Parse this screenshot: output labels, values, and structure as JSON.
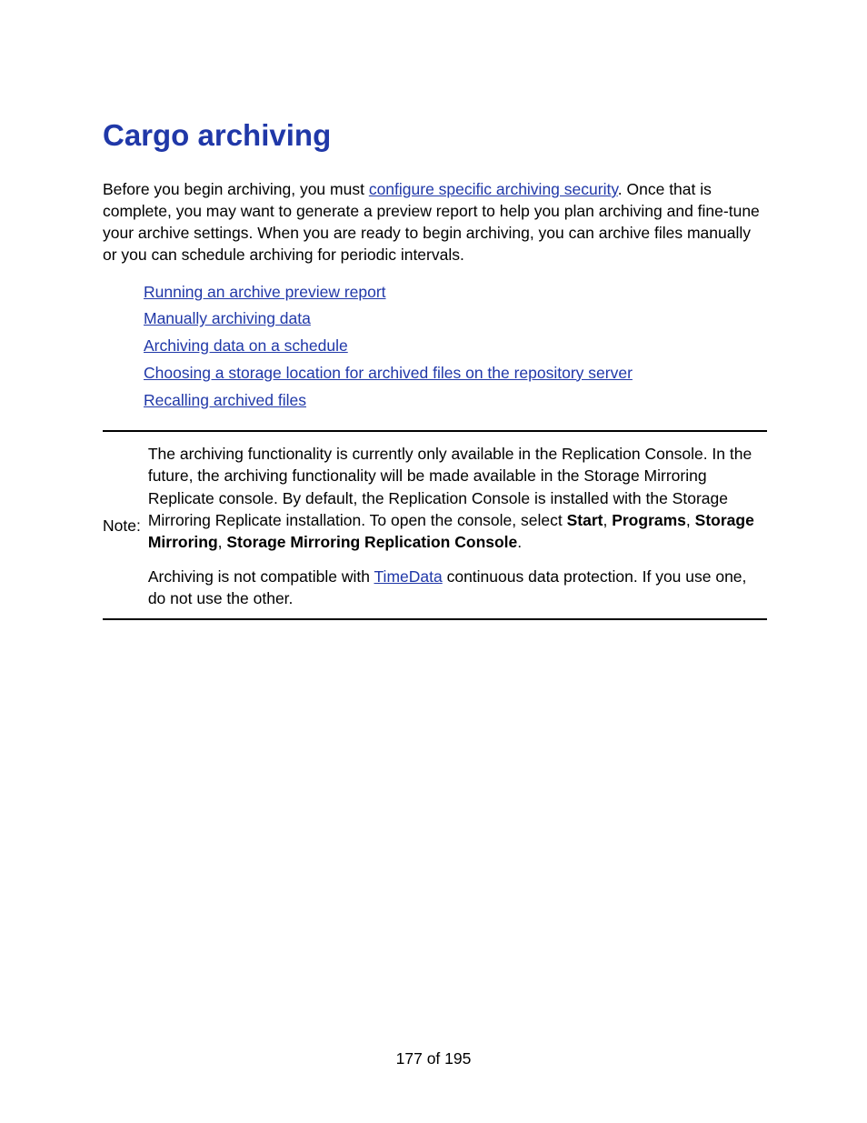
{
  "title": "Cargo archiving",
  "intro_before": "Before you begin archiving, you must ",
  "intro_link": "configure specific archiving security",
  "intro_after": ". Once that is complete, you may want to generate a preview report to help you plan archiving and fine-tune your archive settings. When you are ready to begin archiving, you can archive files manually or you can schedule archiving for periodic intervals.",
  "links": [
    "Running an archive preview report",
    "Manually archiving data",
    "Archiving data on a schedule",
    "Choosing a storage location for archived files on the repository server",
    "Recalling archived files"
  ],
  "note_label": "Note:",
  "note_p1_a": "The archiving functionality is currently only available in the Replication Console. In the future, the archiving functionality will be made available in the Storage Mirroring Replicate console. By default, the Replication Console is installed with the Storage Mirroring Replicate installation. To open the console, select ",
  "note_p1_b1": "Start",
  "note_p1_c": ", ",
  "note_p1_b2": "Programs",
  "note_p1_d": ", ",
  "note_p1_b3": "Storage Mirroring",
  "note_p1_e": ", ",
  "note_p1_b4": "Storage Mirroring Replication Console",
  "note_p1_f": ".",
  "note_p2_a": "Archiving is not compatible with ",
  "note_p2_link": "TimeData",
  "note_p2_b": " continuous data protection. If you use one, do not use the other.",
  "footer": "177 of 195"
}
